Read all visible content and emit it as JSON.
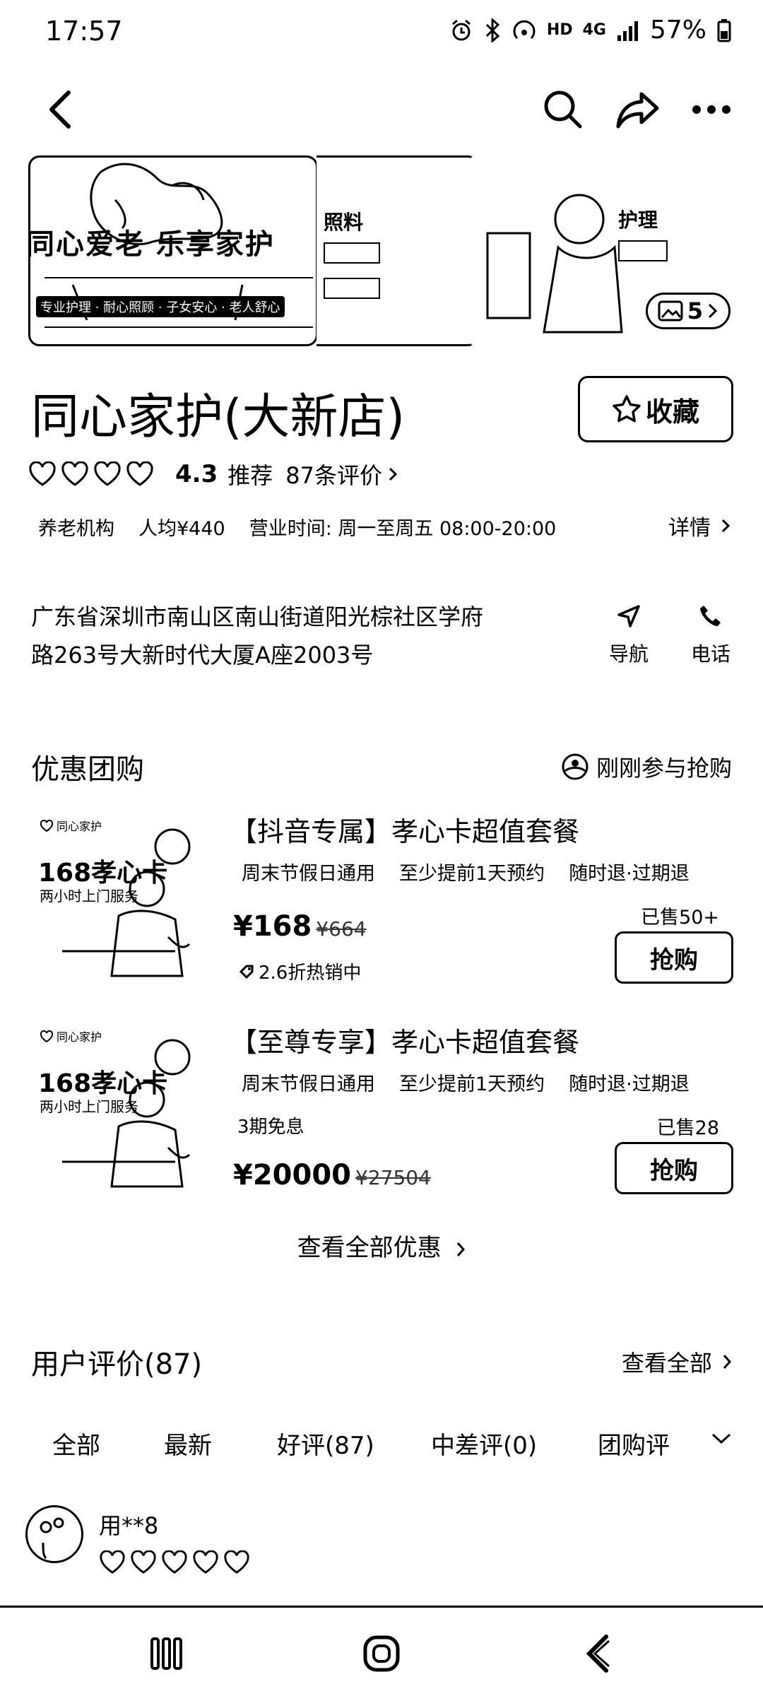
{
  "status_bar": {
    "time": "17:57",
    "network": "HD",
    "signal": "4G",
    "battery": "57%"
  },
  "hero": {
    "banner_text": "同心爱老 乐享家护",
    "banner_tags": "专业护理 · 耐心照顾 · 子女安心 · 老人舒心",
    "card2_label": "照料",
    "card3_label": "护理",
    "photo_count": "5"
  },
  "shop": {
    "name": "同心家护(大新店)",
    "favorite_label": "收藏",
    "rating": "4.3",
    "recommend": "推荐",
    "review_count_link": "87条评价",
    "category": "养老机构",
    "avg_price": "人均¥440",
    "hours": "营业时间: 周一至周五 08:00-20:00",
    "detail_link": "详情",
    "address_line1": "广东省深圳市南山区南山街道阳光棕社区学府",
    "address_line2": "路263号大新时代大厦A座2003号",
    "navigate_label": "导航",
    "phone_label": "电话"
  },
  "deals_section": {
    "title": "优惠团购",
    "recent_buy": "刚刚参与抢购",
    "view_all": "查看全部优惠",
    "items": [
      {
        "thumb_brand": "同心家护",
        "thumb_title": "168孝心卡",
        "thumb_sub": "两小时上门服务",
        "title": "【抖音专属】孝心卡超值套餐",
        "tags": [
          "周末节假日通用",
          "至少提前1天预约",
          "随时退·过期退"
        ],
        "sold": "已售50+",
        "price": "¥168",
        "original_price": "¥664",
        "note": "2.6折热销中",
        "button": "抢购"
      },
      {
        "thumb_brand": "同心家护",
        "thumb_title": "168孝心卡",
        "thumb_sub": "两小时上门服务",
        "title": "【至尊专享】孝心卡超值套餐",
        "tags": [
          "周末节假日通用",
          "至少提前1天预约",
          "随时退·过期退"
        ],
        "installment": "3期免息",
        "sold": "已售28",
        "price": "¥20000",
        "original_price": "¥27504",
        "button": "抢购"
      }
    ]
  },
  "reviews": {
    "title": "用户评价(87)",
    "view_all": "查看全部",
    "tabs": [
      "全部",
      "最新",
      "好评(87)",
      "中差评(0)",
      "团购评"
    ],
    "first": {
      "user": "用**8",
      "hearts": 5
    }
  }
}
